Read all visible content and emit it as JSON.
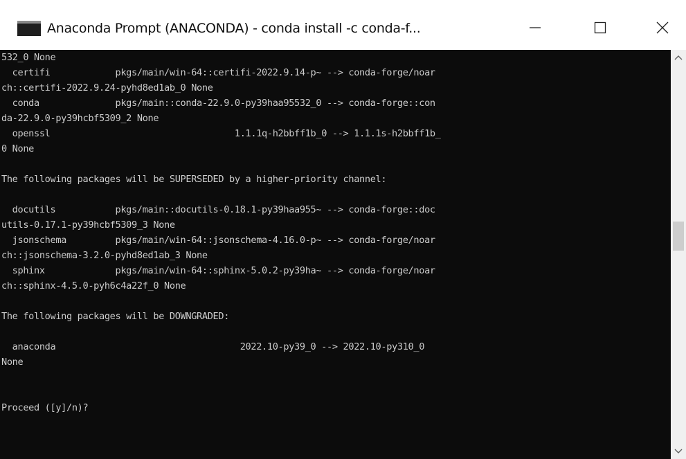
{
  "window": {
    "title": "Anaconda Prompt (ANACONDA) - conda  install -c conda-f...",
    "icon": "terminal-icon",
    "controls": [
      "minimize-icon",
      "maximize-icon",
      "close-icon"
    ]
  },
  "terminal": {
    "lines": [
      "532_0 None",
      "  certifi            pkgs/main/win-64::certifi-2022.9.14-p~ --> conda-forge/noar",
      "ch::certifi-2022.9.24-pyhd8ed1ab_0 None",
      "  conda              pkgs/main::conda-22.9.0-py39haa95532_0 --> conda-forge::con",
      "da-22.9.0-py39hcbf5309_2 None",
      "  openssl                                  1.1.1q-h2bbff1b_0 --> 1.1.1s-h2bbff1b_",
      "0 None",
      "",
      "The following packages will be SUPERSEDED by a higher-priority channel:",
      "",
      "  docutils           pkgs/main::docutils-0.18.1-py39haa955~ --> conda-forge::doc",
      "utils-0.17.1-py39hcbf5309_3 None",
      "  jsonschema         pkgs/main/win-64::jsonschema-4.16.0-p~ --> conda-forge/noar",
      "ch::jsonschema-3.2.0-pyhd8ed1ab_3 None",
      "  sphinx             pkgs/main/win-64::sphinx-5.0.2-py39ha~ --> conda-forge/noar",
      "ch::sphinx-4.5.0-pyh6c4a22f_0 None",
      "",
      "The following packages will be DOWNGRADED:",
      "",
      "  anaconda                                  2022.10-py39_0 --> 2022.10-py310_0",
      "None",
      "",
      "",
      "Proceed ([y]/n)?"
    ]
  },
  "scrollbar": {
    "up_icon": "chevron-up-icon",
    "down_icon": "chevron-down-icon"
  }
}
